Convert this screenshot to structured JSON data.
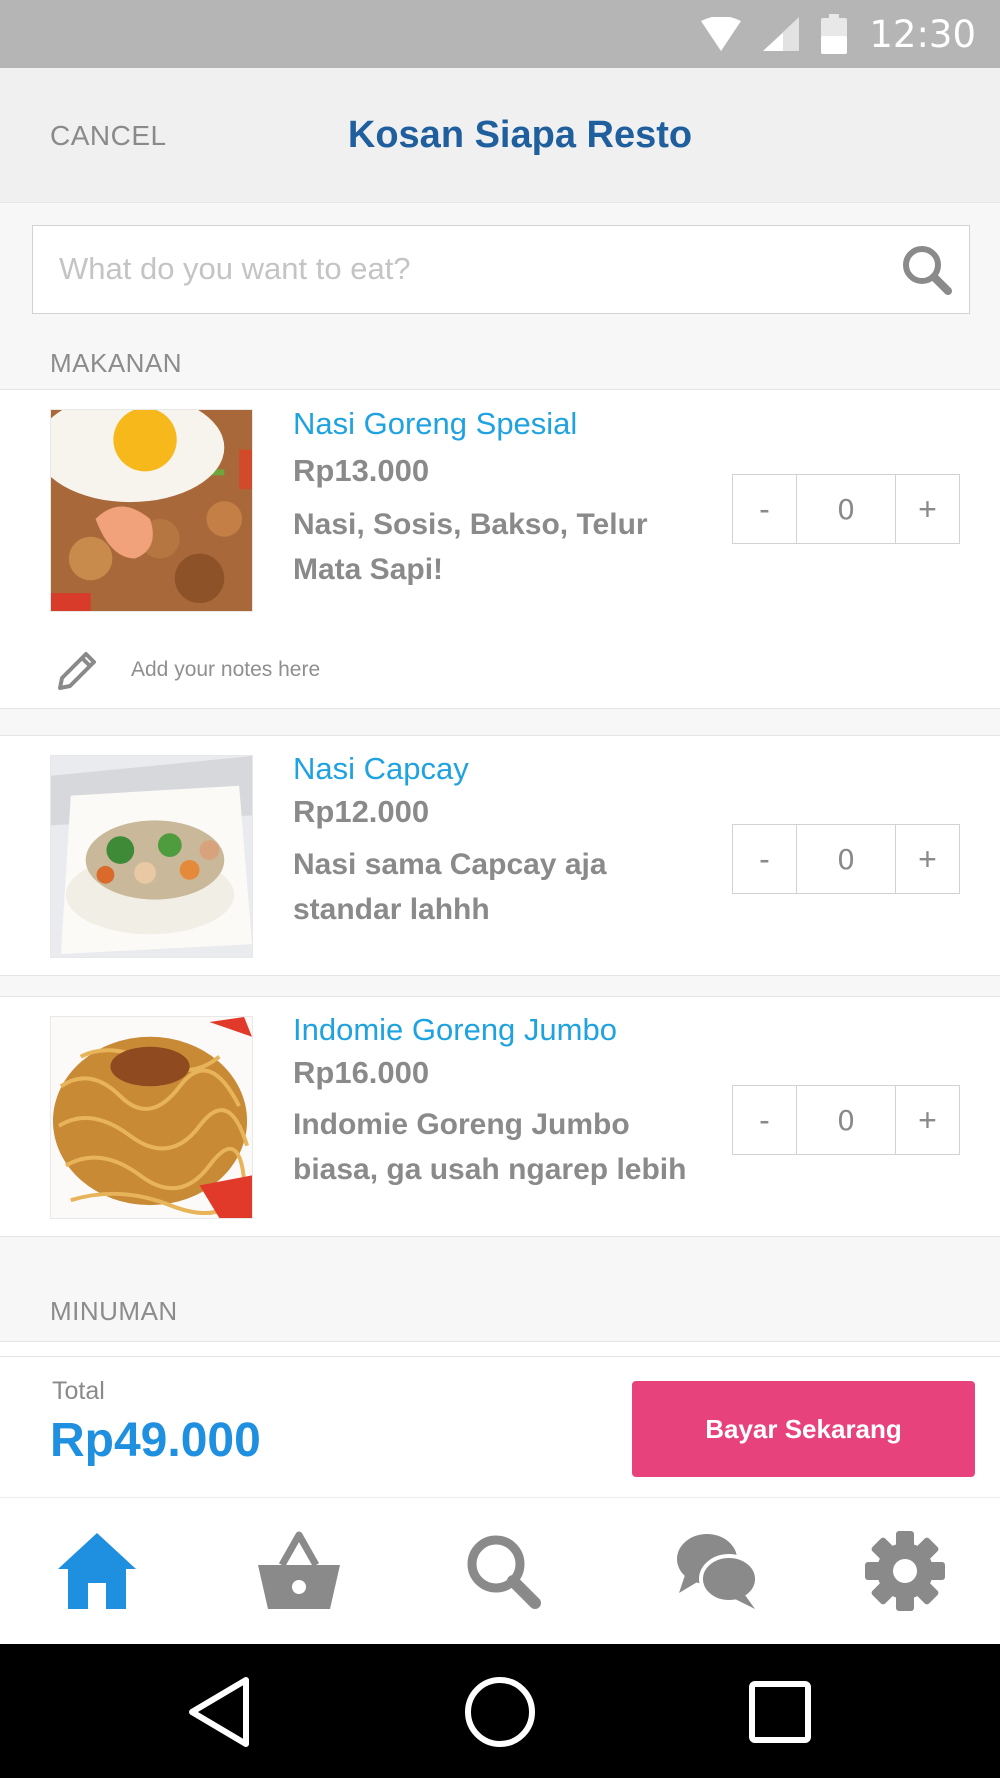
{
  "status_bar": {
    "time": "12:30",
    "icons": [
      "wifi-icon",
      "signal-icon",
      "battery-icon"
    ]
  },
  "header": {
    "cancel_label": "CANCEL",
    "title": "Kosan Siapa Resto"
  },
  "search": {
    "placeholder": "What do you want to eat?"
  },
  "sections": {
    "food": "MAKANAN",
    "drinks": "MINUMAN"
  },
  "menu_items": [
    {
      "name": "Nasi Goreng Spesial",
      "price": "Rp13.000",
      "description": "Nasi, Sosis, Bakso, Telur Mata Sapi!",
      "quantity": "0",
      "image": "fried-rice-with-egg-and-shrimp"
    },
    {
      "name": "Nasi Capcay",
      "price": "Rp12.000",
      "description": "Nasi sama Capcay aja standar lahhh",
      "quantity": "0",
      "image": "rice-with-capcay-vegetables"
    },
    {
      "name": "Indomie Goreng Jumbo",
      "price": "Rp16.000",
      "description": "Indomie Goreng Jumbo biasa, ga usah ngarep lebih",
      "quantity": "0",
      "image": "fried-noodles"
    }
  ],
  "qty_controls": {
    "minus": "-",
    "plus": "+"
  },
  "notes": {
    "placeholder": "Add your notes here"
  },
  "checkout": {
    "total_label": "Total",
    "total_value": "Rp49.000",
    "pay_label": "Bayar Sekarang"
  },
  "bottom_nav": {
    "active": "home",
    "items": [
      "home-icon",
      "basket-icon",
      "search-icon",
      "chat-icon",
      "settings-icon"
    ],
    "active_color": "#1f8fe0",
    "inactive_color": "#8a8a8a"
  },
  "colors": {
    "accent": "#1fa2e0",
    "title": "#1f5f9e",
    "pay_button": "#e8427c"
  }
}
